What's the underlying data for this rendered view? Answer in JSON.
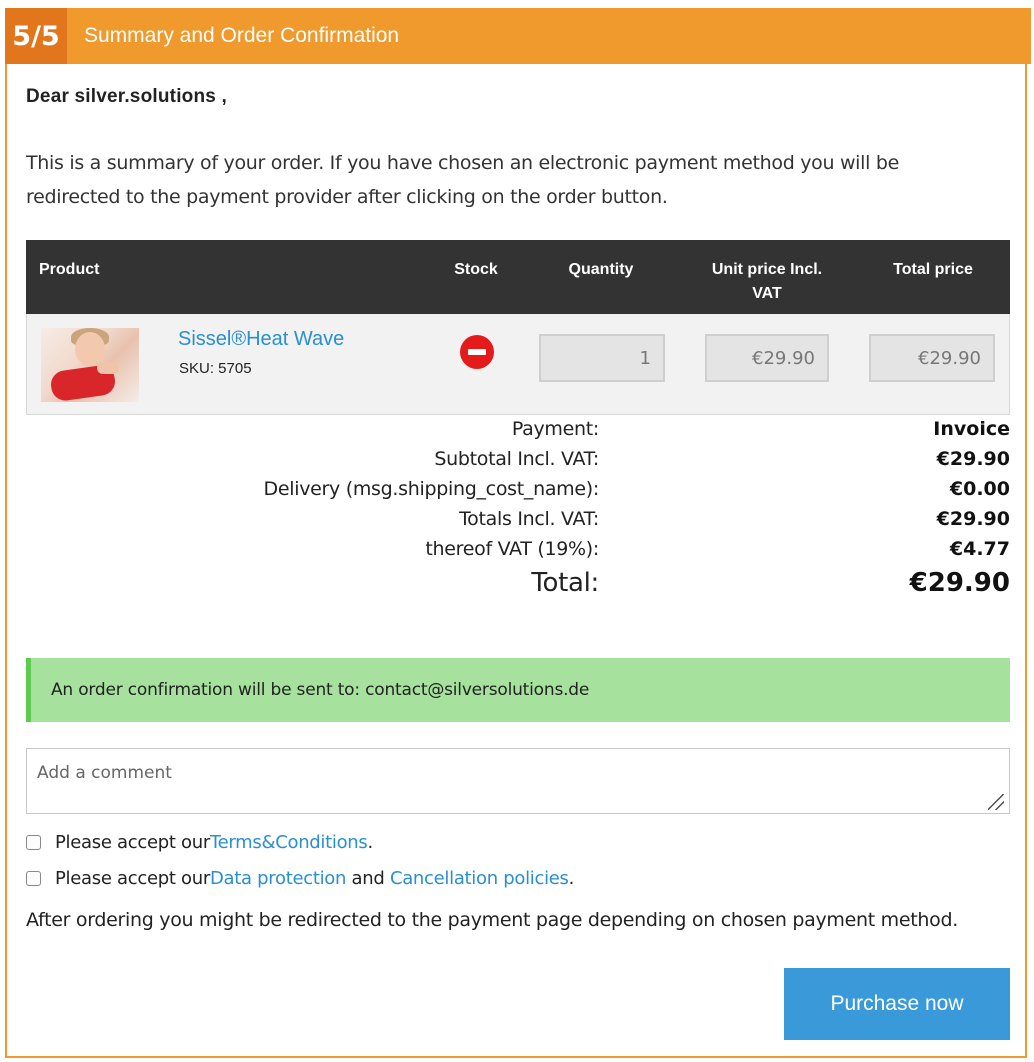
{
  "header": {
    "step": "5/5",
    "title": "Summary and Order Confirmation"
  },
  "greeting": "Dear silver.solutions ,",
  "intro": "This is a summary of your order. If you have chosen an electronic payment method you will be redirected to the payment provider after clicking on the order button.",
  "table": {
    "headers": {
      "product": "Product",
      "stock": "Stock",
      "quantity": "Quantity",
      "unit_price": "Unit price Incl. VAT",
      "total_price": "Total price"
    },
    "rows": [
      {
        "name": "Sissel®Heat Wave",
        "sku": "SKU: 5705",
        "stock_icon": "out-of-stock-icon",
        "quantity": "1",
        "unit_price": "€29.90",
        "total_price": "€29.90"
      }
    ]
  },
  "summary": {
    "payment_label": "Payment:",
    "payment_value": "Invoice",
    "subtotal_label": "Subtotal Incl. VAT:",
    "subtotal_value": "€29.90",
    "delivery_label": "Delivery (msg.shipping_cost_name):",
    "delivery_value": "€0.00",
    "totals_label": "Totals Incl. VAT:",
    "totals_value": "€29.90",
    "vat_label": "thereof VAT (19%):",
    "vat_value": "€4.77",
    "total_label": "Total:",
    "total_value": "€29.90"
  },
  "notice": "An order confirmation will be sent to: contact@silversolutions.de",
  "comment": {
    "placeholder": "Add a comment"
  },
  "terms": {
    "prefix": "Please accept our ",
    "link": "Terms&Conditions",
    "suffix": "."
  },
  "privacy": {
    "prefix": "Please accept our ",
    "link1": "Data protection",
    "middle": " and ",
    "link2": "Cancellation policies",
    "suffix": "."
  },
  "after_text": "After ordering you might be redirected to the payment page depending on chosen payment method.",
  "purchase_button": "Purchase now",
  "colors": {
    "accent_orange": "#f0992c",
    "step_badge": "#e2761d",
    "link_blue": "#2a8fd0",
    "button_blue": "#3a9ad9",
    "notice_green": "#a6e29d",
    "stock_red": "#e51b1b"
  }
}
